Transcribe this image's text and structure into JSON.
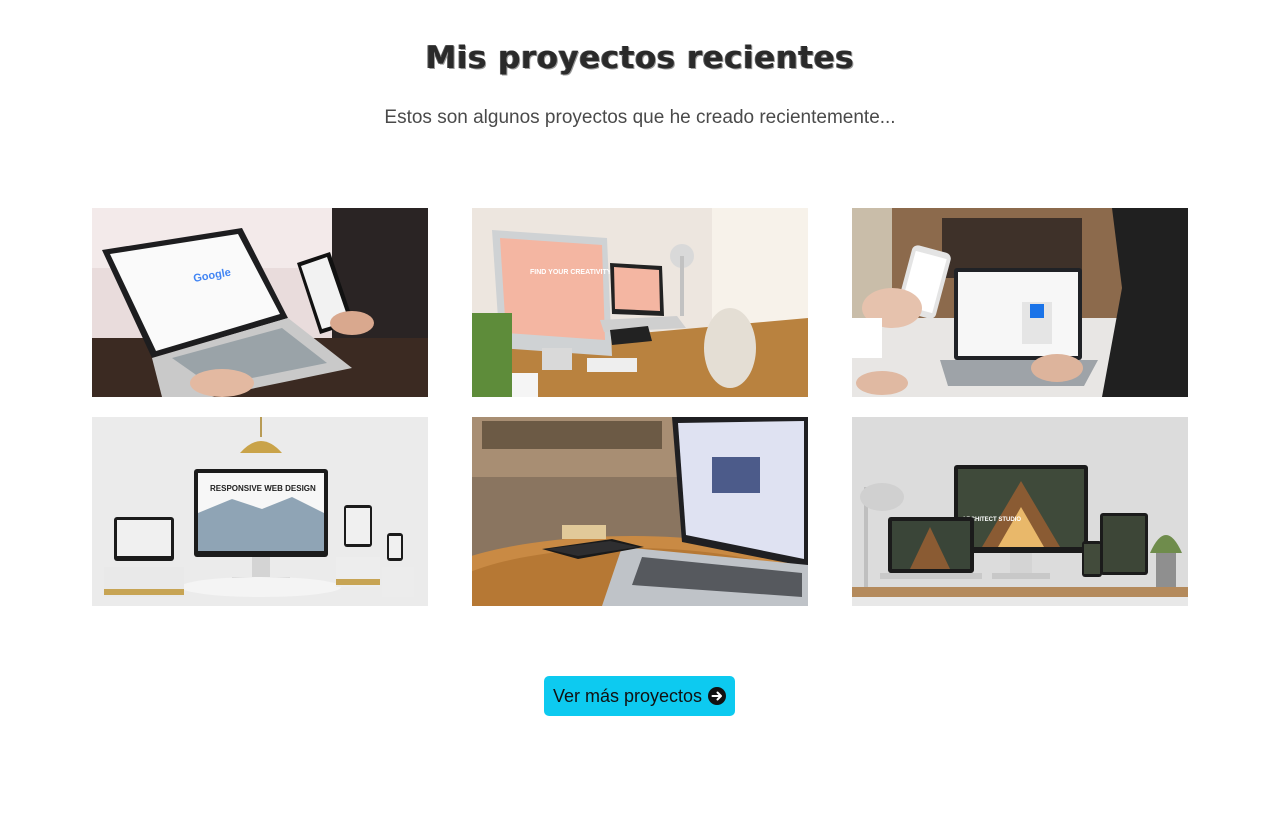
{
  "section": {
    "title": "Mis proyectos recientes",
    "subtitle": "Estos son algunos proyectos que he creado recientemente..."
  },
  "projects": [
    {
      "name": "laptop-phone-google",
      "screen_text": "Google"
    },
    {
      "name": "imac-desk-creativity",
      "screen_text": "FIND YOUR CREATIVITY"
    },
    {
      "name": "phone-laptop-hands",
      "screen_text": ""
    },
    {
      "name": "responsive-devices",
      "screen_text": "RESPONSIVE WEB DESIGN"
    },
    {
      "name": "macbook-table",
      "screen_text": ""
    },
    {
      "name": "architecture-studio",
      "screen_text": "ARCHITECT STUDIO"
    }
  ],
  "cta": {
    "label": "Ver más proyectos",
    "icon": "arrow-right-circle-icon",
    "color": "#0dcaf0"
  }
}
